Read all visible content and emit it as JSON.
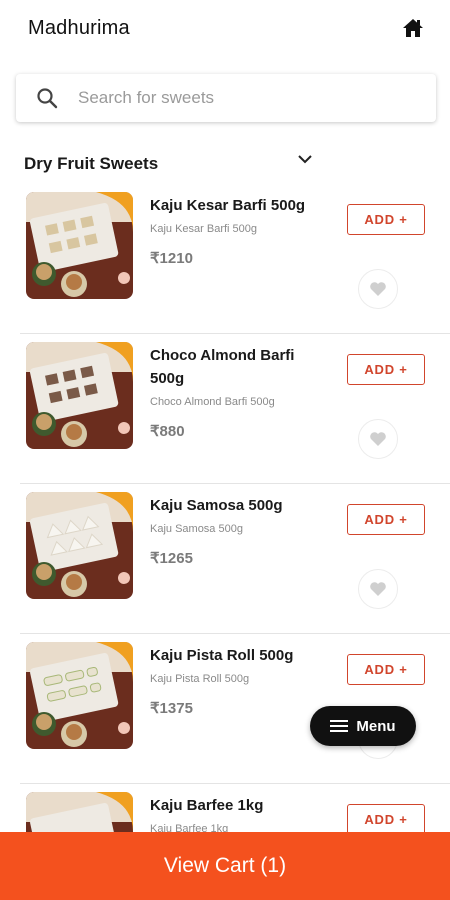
{
  "app": {
    "title": "Madhurima"
  },
  "header": {
    "home_icon": "home-icon"
  },
  "search": {
    "placeholder": "Search for sweets",
    "value": ""
  },
  "category": {
    "title": "Dry Fruit Sweets"
  },
  "products": [
    {
      "name": "Kaju Kesar Barfi 500g",
      "desc": "Kaju Kesar Barfi 500g",
      "price": "₹1210",
      "add_label": "ADD +"
    },
    {
      "name": "Choco Almond Barfi 500g",
      "desc": "Choco Almond Barfi 500g",
      "price": "₹880",
      "add_label": "ADD +"
    },
    {
      "name": "Kaju Samosa 500g",
      "desc": "Kaju Samosa 500g",
      "price": "₹1265",
      "add_label": "ADD +"
    },
    {
      "name": "Kaju Pista Roll 500g",
      "desc": "Kaju Pista Roll 500g",
      "price": "₹1375",
      "add_label": "ADD +"
    },
    {
      "name": "Kaju Barfee 1kg",
      "desc": "Kaju Barfee 1kg",
      "price": "",
      "add_label": "ADD +"
    }
  ],
  "menu_fab": {
    "label": "Menu"
  },
  "cart": {
    "label": "View Cart (1)"
  },
  "colors": {
    "accent": "#f4511e",
    "add_border": "#d1452c",
    "fab": "#111111"
  }
}
